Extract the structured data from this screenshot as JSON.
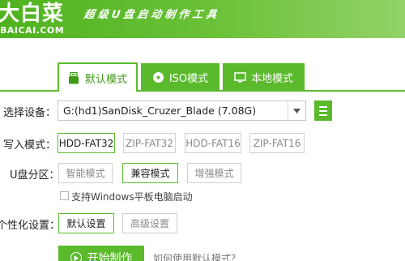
{
  "header": {
    "logo_text": "大白菜",
    "logo_domain": "BAICAI.COM",
    "slogan": "超级U盘启动制作工具"
  },
  "mode_tabs": [
    {
      "label": "默认模式",
      "icon": "usb-icon",
      "active": true
    },
    {
      "label": "ISO模式",
      "icon": "disc-icon",
      "active": false
    },
    {
      "label": "本地模式",
      "icon": "monitor-icon",
      "active": false
    }
  ],
  "device": {
    "label": "选择设备：",
    "value": "G:(hd1)SanDisk_Cruzer_Blade (7.08G)"
  },
  "write_mode": {
    "label": "写入模式：",
    "options": [
      "HDD-FAT32",
      "ZIP-FAT32",
      "HDD-FAT16",
      "ZIP-FAT16"
    ],
    "selected": "HDD-FAT32"
  },
  "partition": {
    "label": "U盘分区：",
    "options": [
      "智能模式",
      "兼容模式",
      "增强模式"
    ],
    "selected": "兼容模式"
  },
  "compat_checkbox": {
    "label": "支持Windows平板电脑启动",
    "checked": false
  },
  "personalize": {
    "label": "个性化设置：",
    "options": [
      "默认设置",
      "高级设置"
    ],
    "selected": "默认设置"
  },
  "actions": {
    "start_label": "开始制作",
    "help_link": "如何使用默认模式？"
  },
  "colors": {
    "accent": "#5aba2c",
    "header_start": "#4fb21e",
    "header_end": "#93d268"
  }
}
